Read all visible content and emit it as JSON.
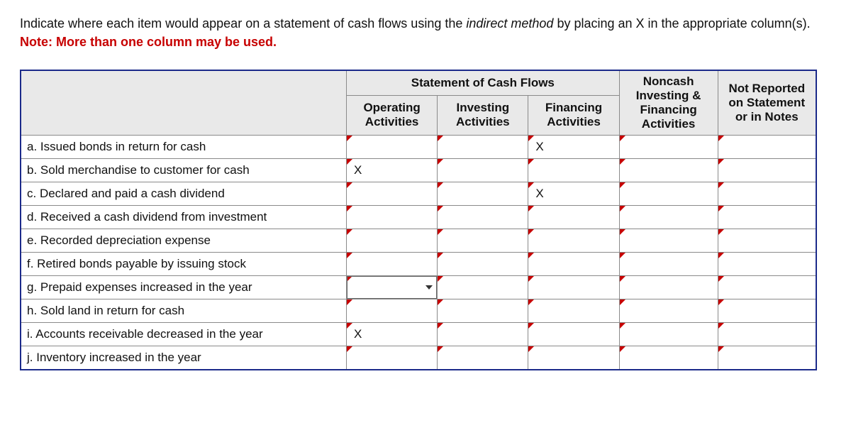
{
  "instructions": {
    "line1a": "Indicate where each item would appear on a statement of cash flows using the ",
    "italic": "indirect method",
    "line1b": " by placing an X in the appropriate column(s).",
    "note": "Note: More than one column may be used."
  },
  "headers": {
    "group": "Statement of Cash Flows",
    "operating": "Operating Activities",
    "investing": "Investing Activities",
    "financing": "Financing Activities",
    "noncash": "Noncash Investing & Financing Activities",
    "notreported": "Not Reported on Statement or in Notes"
  },
  "rows": [
    {
      "label": "a. Issued bonds in return for cash",
      "vals": [
        "",
        "",
        "X",
        "",
        ""
      ]
    },
    {
      "label": "b. Sold merchandise to customer for cash",
      "vals": [
        "X",
        "",
        "",
        "",
        ""
      ]
    },
    {
      "label": "c. Declared and paid a cash dividend",
      "vals": [
        "",
        "",
        "X",
        "",
        ""
      ]
    },
    {
      "label": "d. Received a cash dividend from investment",
      "vals": [
        "",
        "",
        "",
        "",
        ""
      ]
    },
    {
      "label": "e. Recorded depreciation expense",
      "vals": [
        "",
        "",
        "",
        "",
        ""
      ]
    },
    {
      "label": "f. Retired bonds payable by issuing stock",
      "vals": [
        "",
        "",
        "",
        "",
        ""
      ]
    },
    {
      "label": "g. Prepaid expenses increased in the year",
      "vals": [
        "",
        "",
        "",
        "",
        ""
      ]
    },
    {
      "label": "h. Sold land in return for cash",
      "vals": [
        "",
        "",
        "",
        "",
        ""
      ]
    },
    {
      "label": "i. Accounts receivable decreased in the year",
      "vals": [
        "X",
        "",
        "",
        "",
        ""
      ]
    },
    {
      "label": "j. Inventory increased in the year",
      "vals": [
        "",
        "",
        "",
        "",
        ""
      ]
    }
  ],
  "activeCell": {
    "row": 6,
    "col": 0
  }
}
